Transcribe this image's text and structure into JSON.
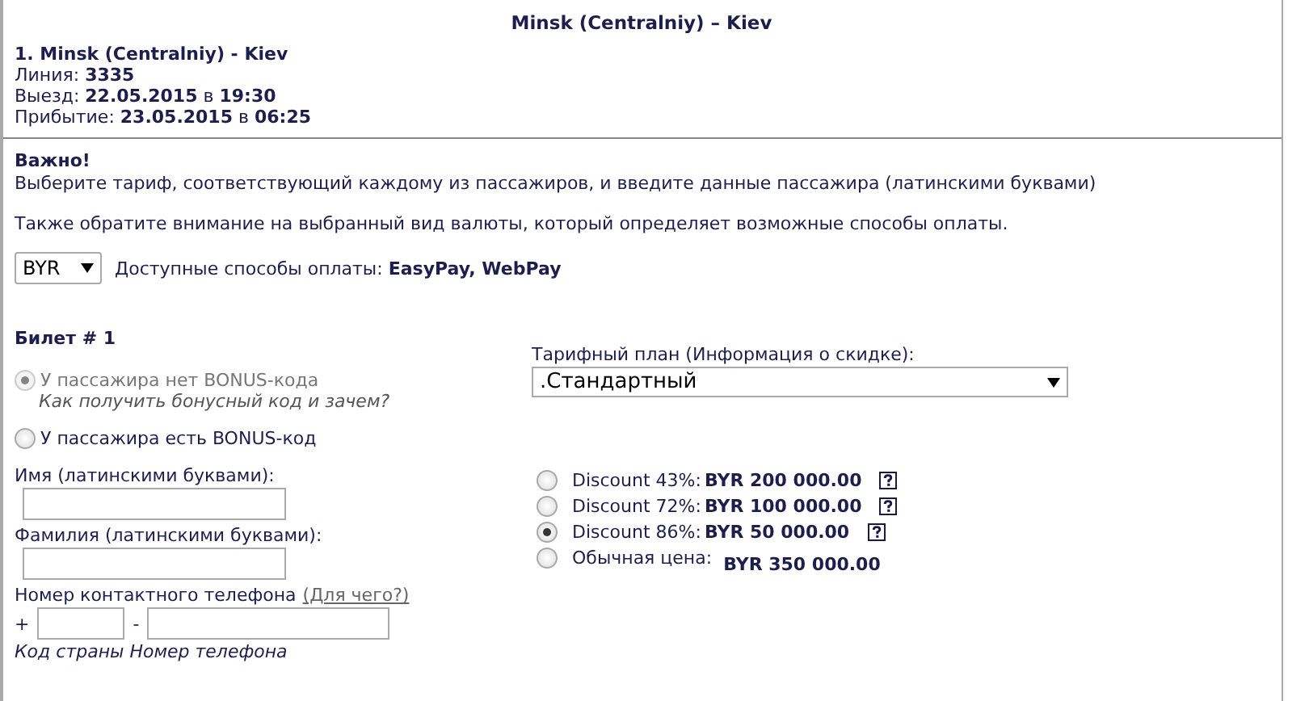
{
  "title": "Minsk (Centralniy) – Kiev",
  "trip": {
    "name": "1. Minsk (Centralniy) - Kiev",
    "lines": [
      "Линия: **3335**",
      "Выезд: **22.05.2015** в **19:30**",
      "Прибытие: **23.05.2015** в **06:25**"
    ]
  },
  "notice": {
    "heading": "Важно!",
    "text": "Выберите тариф, соответствующий каждому из пассажиров, и введите данные пассажира (латинскими буквами)",
    "currency_note": "Также обратите внимание на выбранный вид валюты, который определяет возможные способы оплаты."
  },
  "currency": {
    "value": "BYR",
    "payment": "Доступные способы оплаты: **EasyPay, WebPay**"
  },
  "ticket": {
    "title": "Билет # 1",
    "bonus_options": [
      {
        "label": "У пассажира нет BONUS-кода",
        "selected": true,
        "disabled": true,
        "hint": "Как получить бонусный код и зачем?"
      },
      {
        "label": "У пассажира есть BONUS-код",
        "selected": false,
        "disabled": false
      }
    ],
    "fields": [
      {
        "label": "Имя (латинскими буквами):"
      },
      {
        "label": "Фамилия (латинскими буквами):"
      }
    ],
    "phone": {
      "label": "Номер контактного телефона",
      "help_link": "(Для чего?)",
      "plus": "+",
      "dash": "-",
      "hint": "Код страны Номер телефона"
    },
    "tariff": {
      "label": "Тарифный план (Информация о скидке):",
      "value": ".Стандартный"
    },
    "fares": [
      {
        "kind": "discount",
        "label": "Discount 43%:",
        "price": "BYR 200 000.00",
        "selected": false
      },
      {
        "kind": "discount",
        "label": "Discount 72%:",
        "price": "BYR 100 000.00",
        "selected": false
      },
      {
        "kind": "discount",
        "label": "Discount 86%:",
        "price": "BYR 50 000.00",
        "selected": true
      },
      {
        "kind": "regular",
        "label": "Обычная цена:",
        "price": "BYR 350 000.00",
        "selected": false
      }
    ]
  }
}
